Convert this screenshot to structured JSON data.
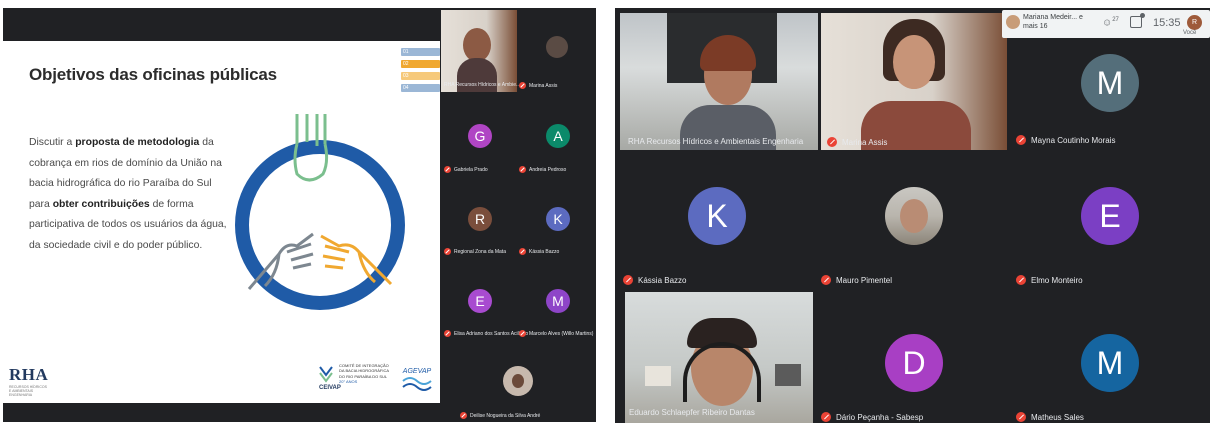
{
  "left_screen": {
    "slide": {
      "title": "Objetivos das oficinas públicas",
      "text_parts": [
        "Discutir a ",
        "proposta de metodologia",
        " da cobrança em rios de domínio da União na bacia hidrográfica do rio Paraíba do Sul para ",
        "obter contribuições",
        " de forma participativa de todos os usuários da água, da sociedade civil e do poder público."
      ],
      "tabs": [
        "01",
        "02",
        "03",
        "04"
      ],
      "rha_logo": "RHA",
      "rha_sub": "RECURSOS HÍDRICOS E AMBIENTAIS ENGENHARIA",
      "ceivap_word": "CEIVAP",
      "ceivap_text": "Comitê de Integração da Bacia Hidrográfica do Rio Paraíba do Sul",
      "ceivap_years": "20° ANOS",
      "agevap_word": "AGEVAP",
      "colors": {
        "ring": "#1f5ba7",
        "green_hand": "#7bbf8e",
        "gray_hand": "#7d8790",
        "orange_hand": "#f0a830",
        "tab_orange": "#f0a830",
        "tab_blue": "#9bb7d6"
      }
    },
    "participants": [
      {
        "name": "RHA Recursos Hídricos e Ambie...",
        "initial": "",
        "color": "#3c4043",
        "video": true
      },
      {
        "name": "Marina Assis",
        "initial": "",
        "color": "#3c4043",
        "video": true
      },
      {
        "name": "Gabriela Prado",
        "initial": "G",
        "color": "#b045c4"
      },
      {
        "name": "Andreia Pedroso",
        "initial": "A",
        "color": "#0b8a6a"
      },
      {
        "name": "Regional Zona da Mata",
        "initial": "R",
        "color": "#7a4e3c"
      },
      {
        "name": "Kássia Bazzo",
        "initial": "K",
        "color": "#5c6bc0"
      },
      {
        "name": "Elisa Adriano dos Santos Aciliano",
        "initial": "E",
        "color": "#a84bd0"
      },
      {
        "name": "Marcelo Alves (Willo Martins)",
        "initial": "M",
        "color": "#8e45c8"
      },
      {
        "name": "Deilise Nogueira da Silva André",
        "initial": "",
        "color": "#3c4043",
        "video": true
      }
    ]
  },
  "right_screen": {
    "topbar": {
      "host": "Mariana Medeir... e mais 16",
      "people_count": "27",
      "clock": "15:35",
      "you_label": "Você",
      "you_initial": "R"
    },
    "tiles": [
      {
        "name": "RHA Recursos Hídricos e Ambientais Engenharia",
        "initial": "",
        "color": "#3c4043",
        "video": true
      },
      {
        "name": "Marina Assis",
        "initial": "",
        "color": "#3c4043",
        "video": true
      },
      {
        "name": "Mayna Coutinho Morais",
        "initial": "M",
        "color": "#546e7a"
      },
      {
        "name": "Kássia Bazzo",
        "initial": "K",
        "color": "#5c6bc0"
      },
      {
        "name": "Mauro Pimentel",
        "initial": "",
        "color": "#3c4043",
        "video": true
      },
      {
        "name": "Elmo Monteiro",
        "initial": "E",
        "color": "#7b3fc4"
      },
      {
        "name": "Eduardo Schlaepfer Ribeiro Dantas",
        "initial": "",
        "color": "#3c4043",
        "video": true
      },
      {
        "name": "Dário Peçanha - Sabesp",
        "initial": "D",
        "color": "#a83fc4"
      },
      {
        "name": "Matheus Sales",
        "initial": "M",
        "color": "#1565a0"
      }
    ]
  }
}
